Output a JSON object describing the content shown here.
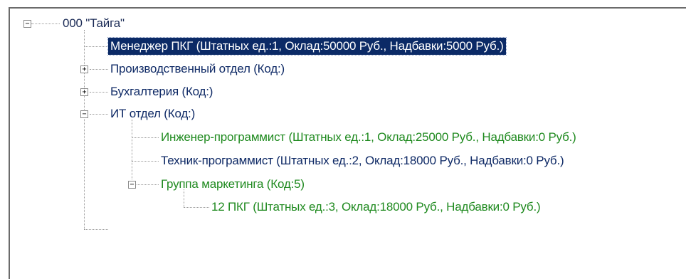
{
  "tree": {
    "root": {
      "label": "000 \"Тайга\"",
      "toggle": "−"
    },
    "nodes": [
      {
        "label": "Менеджер ПКГ (Штатных ед.:1, Оклад:50000 Руб., Надбавки:5000 Руб.)",
        "selected": true
      },
      {
        "label": "Производственный отдел (Код:)",
        "toggle": "+"
      },
      {
        "label": "Бухгалтерия (Код:)",
        "toggle": "+"
      },
      {
        "label": "ИТ отдел (Код:)",
        "toggle": "−"
      },
      {
        "label": "Инженер-программист (Штатных ед.:1, Оклад:25000 Руб., Надбавки:0 Руб.)"
      },
      {
        "label": "Техник-программист (Штатных ед.:2, Оклад:18000 Руб., Надбавки:0 Руб.)"
      },
      {
        "label": "Группа маркетинга (Код:5)",
        "toggle": "−"
      },
      {
        "label": "12 ПКГ (Штатных ед.:3, Оклад:18000 Руб., Надбавки:0 Руб.)"
      }
    ]
  },
  "colors": {
    "selection_bg": "#0b2a66",
    "text_dark": "#1a2a55",
    "text_green": "#1f8a1f",
    "lines": "#9a9a9a"
  }
}
